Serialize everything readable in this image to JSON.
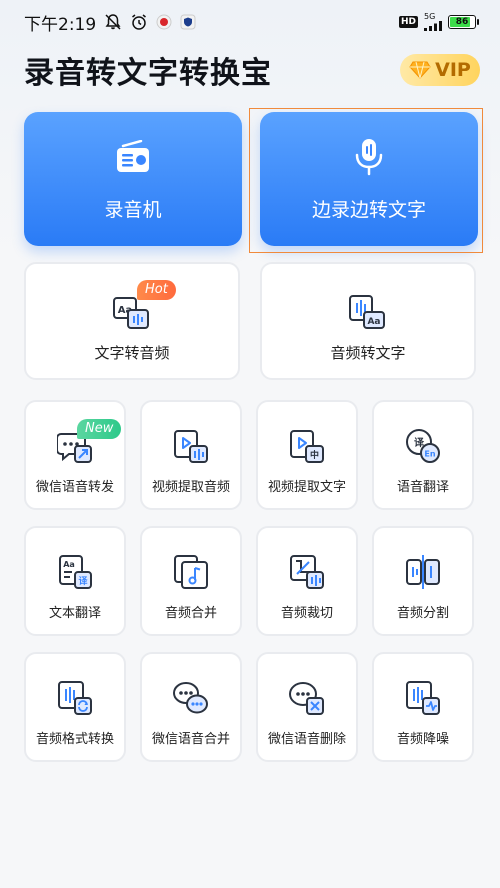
{
  "status_bar": {
    "time": "下午2:19",
    "hd": "HD",
    "network": "5G",
    "battery": "86",
    "battery_level": 0.86
  },
  "header": {
    "title": "录音转文字转换宝",
    "vip_label": "VIP"
  },
  "primary_actions": [
    {
      "label": "录音机",
      "icon": "radio-icon"
    },
    {
      "label": "边录边转文字",
      "icon": "microphone-icon"
    }
  ],
  "secondary_actions": [
    {
      "label": "文字转音频",
      "icon": "text-to-audio-icon",
      "badge": "Hot"
    },
    {
      "label": "音频转文字",
      "icon": "audio-to-text-icon"
    }
  ],
  "tools": [
    {
      "label": "微信语音转发",
      "icon": "wechat-forward-icon",
      "badge": "New"
    },
    {
      "label": "视频提取音频",
      "icon": "video-extract-audio-icon"
    },
    {
      "label": "视频提取文字",
      "icon": "video-extract-text-icon"
    },
    {
      "label": "语音翻译",
      "icon": "voice-translate-icon"
    },
    {
      "label": "文本翻译",
      "icon": "text-translate-icon"
    },
    {
      "label": "音频合并",
      "icon": "audio-merge-icon"
    },
    {
      "label": "音频裁切",
      "icon": "audio-cut-icon"
    },
    {
      "label": "音频分割",
      "icon": "audio-split-icon"
    },
    {
      "label": "音频格式转换",
      "icon": "audio-format-convert-icon"
    },
    {
      "label": "微信语音合并",
      "icon": "wechat-voice-merge-icon"
    },
    {
      "label": "微信语音删除",
      "icon": "wechat-voice-delete-icon"
    },
    {
      "label": "音频降噪",
      "icon": "audio-denoise-icon"
    }
  ],
  "colors": {
    "primary_blue": "#2a7bf6",
    "icon_dark": "#2b3340",
    "icon_accent": "#3a86ff",
    "hot_badge": "#ff6a3d",
    "new_badge": "#2cc98a",
    "vip_gold": "#ffd45e"
  }
}
